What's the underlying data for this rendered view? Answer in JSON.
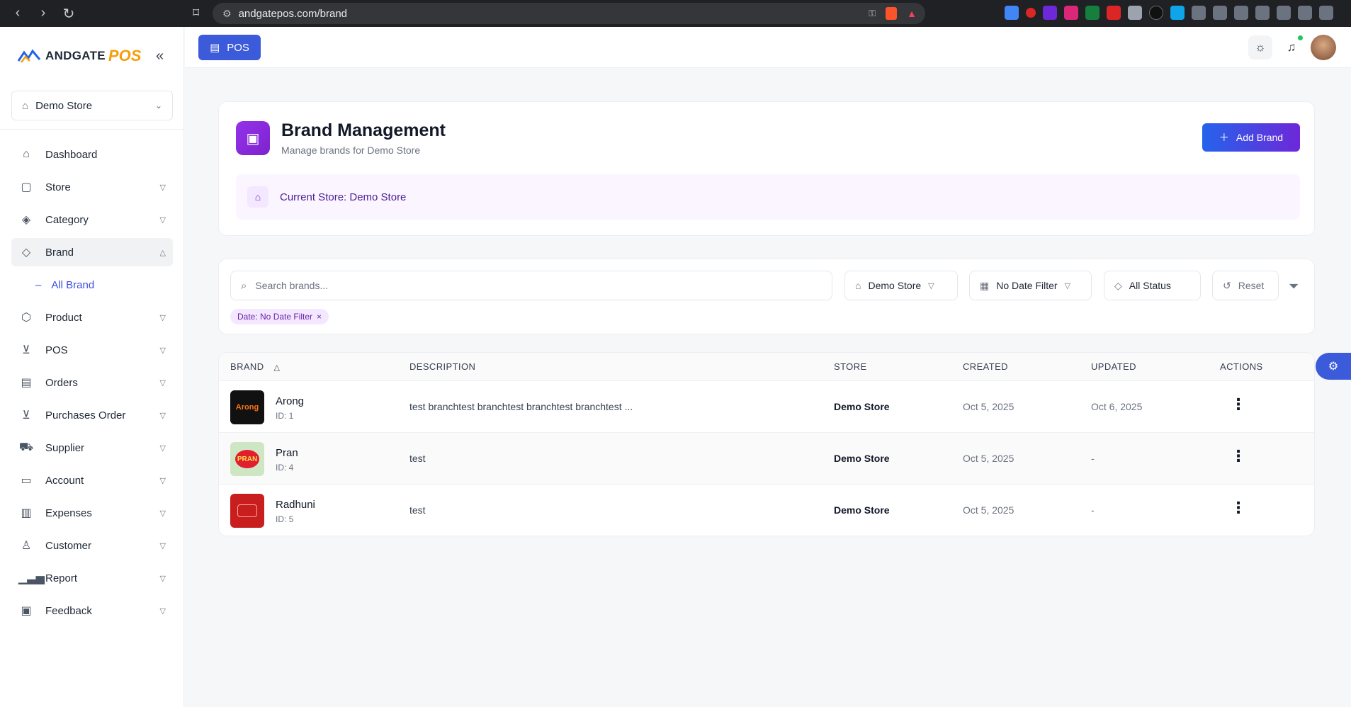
{
  "browser": {
    "url": "andgatepos.com/brand"
  },
  "app": {
    "logo_text": "ANDGATE",
    "logo_accent": "POS",
    "accent_color": "#3b5bdb",
    "brand_purple": "#7e22ce"
  },
  "sidebar": {
    "store_select": "Demo Store",
    "items": [
      {
        "label": "Dashboard",
        "icon": "home-icon",
        "expandable": false
      },
      {
        "label": "Store",
        "icon": "store-icon",
        "expandable": true
      },
      {
        "label": "Category",
        "icon": "layers-icon",
        "expandable": true
      },
      {
        "label": "Brand",
        "icon": "tag-icon",
        "expandable": true,
        "active": true
      },
      {
        "label": "Product",
        "icon": "box-icon",
        "expandable": true
      },
      {
        "label": "POS",
        "icon": "cart-icon",
        "expandable": true
      },
      {
        "label": "Orders",
        "icon": "document-icon",
        "expandable": true
      },
      {
        "label": "Purchases Order",
        "icon": "cart-icon",
        "expandable": true
      },
      {
        "label": "Supplier",
        "icon": "truck-icon",
        "expandable": true
      },
      {
        "label": "Account",
        "icon": "wallet-icon",
        "expandable": true
      },
      {
        "label": "Expenses",
        "icon": "receipt-icon",
        "expandable": true
      },
      {
        "label": "Customer",
        "icon": "users-icon",
        "expandable": true
      },
      {
        "label": "Report",
        "icon": "bar-chart-icon",
        "expandable": true
      },
      {
        "label": "Feedback",
        "icon": "chat-icon",
        "expandable": true
      }
    ],
    "sub_item": "All Brand"
  },
  "topbar": {
    "pos_label": "POS"
  },
  "header": {
    "title": "Brand Management",
    "subtitle": "Manage brands for Demo Store",
    "add_label": "Add Brand",
    "current_store": "Current Store: Demo Store"
  },
  "filters": {
    "search_placeholder": "Search brands...",
    "store": "Demo Store",
    "date": "No Date Filter",
    "status": "All Status",
    "reset": "Reset",
    "chip": "Date: No Date Filter"
  },
  "table": {
    "columns": [
      "BRAND",
      "DESCRIPTION",
      "STORE",
      "CREATED",
      "UPDATED",
      "ACTIONS"
    ],
    "rows": [
      {
        "name": "Arong",
        "id": "ID: 1",
        "description": "test branchtest branchtest branchtest branchtest ...",
        "store": "Demo Store",
        "created": "Oct 5, 2025",
        "updated": "Oct 6, 2025",
        "logo_color": "#111111"
      },
      {
        "name": "Pran",
        "id": "ID: 4",
        "description": "test",
        "store": "Demo Store",
        "created": "Oct 5, 2025",
        "updated": "-",
        "logo_color": "#e11d2e"
      },
      {
        "name": "Radhuni",
        "id": "ID: 5",
        "description": "test",
        "store": "Demo Store",
        "created": "Oct 5, 2025",
        "updated": "-",
        "logo_color": "#c81e1e"
      }
    ]
  }
}
